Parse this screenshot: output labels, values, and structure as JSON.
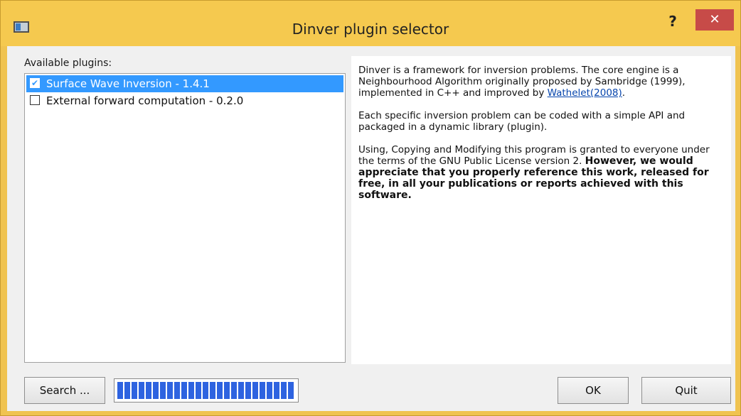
{
  "window": {
    "title": "Dinver plugin selector",
    "help_label": "?",
    "close_label": "✕",
    "icon": "app-window-icon"
  },
  "plugins": {
    "label": "Available plugins:",
    "items": [
      {
        "label": "Surface Wave Inversion - 1.4.1",
        "checked": true,
        "selected": true
      },
      {
        "label": "External forward computation - 0.2.0",
        "checked": false,
        "selected": false
      }
    ]
  },
  "description": {
    "p1_text": "Dinver is a framework for inversion problems. The core engine is a Neighbourhood Algorithm originally proposed by Sambridge (1999), implemented in C++ and improved by ",
    "p1_link": "Wathelet(2008)",
    "p1_end": ".",
    "p2": "Each specific inversion problem can be coded with a simple API and packaged in a dynamic library (plugin).",
    "p3_text": "Using, Copying and Modifying this program is granted to everyone under the terms of the GNU Public License version 2. ",
    "p3_bold": "However, we would appreciate that you properly reference this work, released for free, in all your publications or reports achieved with this software."
  },
  "buttons": {
    "search": "Search ...",
    "ok": "OK",
    "quit": "Quit"
  },
  "progress": {
    "value": 1.0
  },
  "colors": {
    "titlebar": "#f5c94f",
    "close": "#c74b48",
    "selection": "#3399ff",
    "progress": "#2e63e0"
  }
}
